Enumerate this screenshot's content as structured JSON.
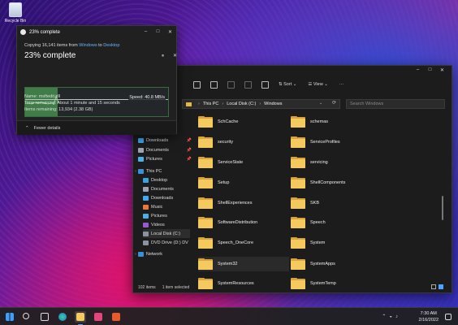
{
  "desktop": {
    "recycle_bin_label": "Recycle Bin"
  },
  "copy_dialog": {
    "title": "23% complete",
    "from_prefix": "Copying 16,141 items from ",
    "source": "Windows",
    "to_word": " to ",
    "destination": "Desktop",
    "percent_text": "23% complete",
    "progress_fraction": 0.23,
    "speed": "Speed: 40.8 MB/s",
    "name": "Name:  msftedit.dll",
    "time_remaining": "Time remaining:  About 1 minute and 15 seconds",
    "items_remaining": "Items remaining:  13,934 (2.38 GB)",
    "fewer_details": "Fewer details"
  },
  "explorer": {
    "toolbar": {
      "sort_label": "Sort",
      "view_label": "View"
    },
    "path": [
      "This PC",
      "Local Disk (C:)",
      "Windows"
    ],
    "search_placeholder": "Search Windows",
    "nav": [
      {
        "label": "Downloads",
        "icon": "downloads-icon",
        "pinned": true
      },
      {
        "label": "Documents",
        "icon": "documents-icon",
        "pinned": true
      },
      {
        "label": "Pictures",
        "icon": "pictures-icon",
        "pinned": true
      },
      {
        "label": "This PC",
        "icon": "pc-icon",
        "pinned": false
      },
      {
        "label": "Desktop",
        "icon": "desktop-icon",
        "pinned": false
      },
      {
        "label": "Documents",
        "icon": "documents-icon",
        "pinned": false
      },
      {
        "label": "Downloads",
        "icon": "downloads-icon",
        "pinned": false
      },
      {
        "label": "Music",
        "icon": "music-icon",
        "pinned": false
      },
      {
        "label": "Pictures",
        "icon": "pictures-icon",
        "pinned": false
      },
      {
        "label": "Videos",
        "icon": "videos-icon",
        "pinned": false
      },
      {
        "label": "Local Disk (C:)",
        "icon": "drive-icon",
        "pinned": false
      },
      {
        "label": "DVD Drive (D:) DV",
        "icon": "dvd-icon",
        "pinned": false
      },
      {
        "label": "Network",
        "icon": "network-icon",
        "pinned": false
      }
    ],
    "folders_left": [
      "SchCache",
      "security",
      "ServiceState",
      "Setup",
      "ShellExperiences",
      "SoftwareDistribution",
      "Speech_OneCore",
      "System32",
      "SystemResources"
    ],
    "folders_right": [
      "schemas",
      "ServiceProfiles",
      "servicing",
      "ShellComponents",
      "SKB",
      "Speech",
      "System",
      "SystemApps",
      "SystemTemp"
    ],
    "status_items": "102 items",
    "status_selected": "1 item selected"
  },
  "taskbar": {
    "time": "7:30 AM",
    "date": "2/16/2022",
    "apps": [
      "start-icon",
      "search-icon",
      "task-view-icon",
      "edge-icon",
      "file-explorer-icon",
      "store-icon",
      "media-icon"
    ]
  },
  "colors": {
    "folder": "#f4c95d",
    "progress_fill": "#3f7c48",
    "link": "#68b4ff",
    "accent": "#4aa3ff"
  }
}
